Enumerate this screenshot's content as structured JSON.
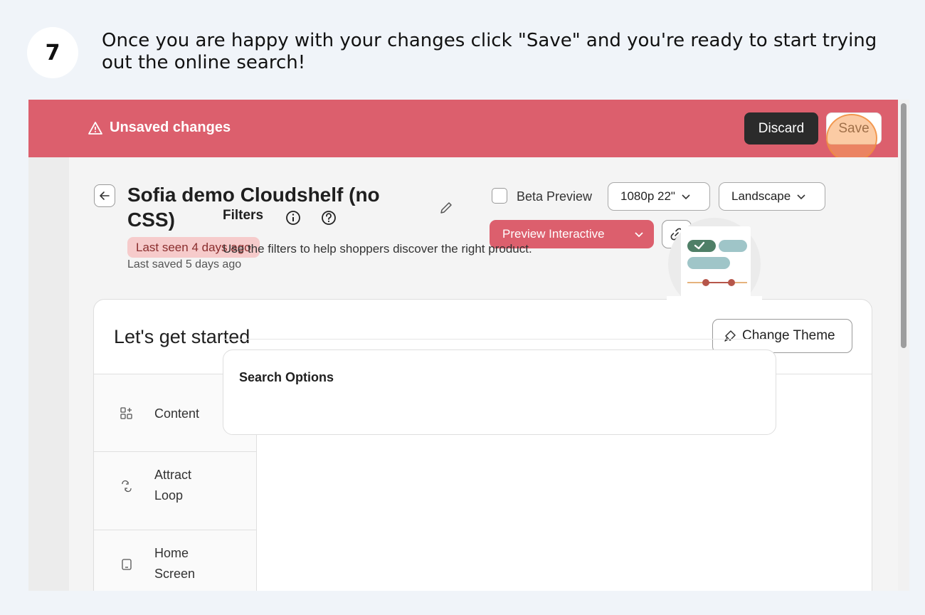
{
  "step": {
    "number": "7",
    "instruction": "Once you are happy with your changes click \"Save\" and you're ready to start trying out the online search!"
  },
  "save_bar": {
    "message": "Unsaved changes",
    "discard_label": "Discard",
    "save_label": "Save"
  },
  "header": {
    "title": "Sofia demo Cloudshelf (no CSS)",
    "last_seen": "Last seen 4 days ago",
    "last_saved": "Last saved 5 days ago",
    "beta_preview_label": "Beta Preview",
    "resolution_value": "1080p 22\"",
    "orientation_value": "Landscape",
    "preview_label": "Preview Interactive"
  },
  "card": {
    "title": "Let's get started",
    "change_theme_label": "Change Theme"
  },
  "sidebar": {
    "items": [
      {
        "label": "Content",
        "icon": "content-grid-icon"
      },
      {
        "label": "Attract\nLoop",
        "icon": "attract-loop-icon"
      },
      {
        "label": "Home\nScreen",
        "icon": "home-screen-icon"
      }
    ]
  },
  "main": {
    "filters_title": "Filters",
    "filters_description": "Use the filters to help shoppers discover the right product.",
    "search_options_title": "Search Options"
  },
  "colors": {
    "accent": "#dc5f6d",
    "badge_bg": "#f6cbcb",
    "discard_bg": "#2b2b2b"
  }
}
